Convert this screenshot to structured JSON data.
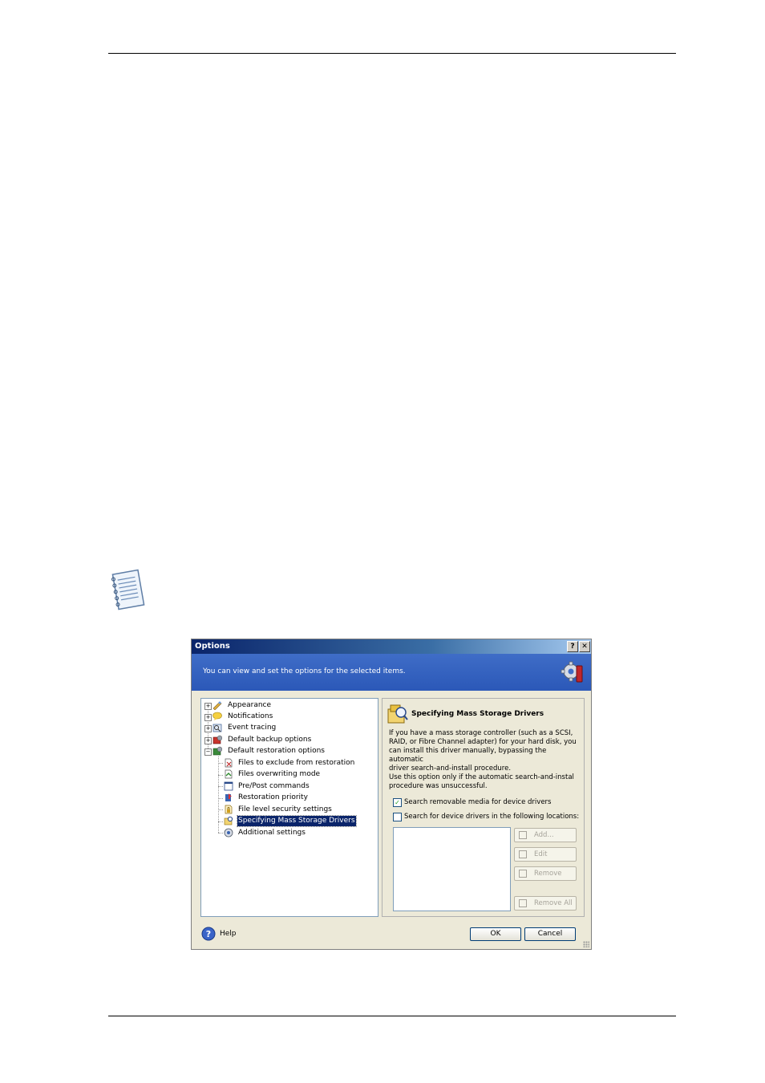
{
  "dialog": {
    "title": "Options",
    "help_btn": "?",
    "close_btn": "✕",
    "header_text": "You can view and set the options for the selected items."
  },
  "tree": {
    "items": [
      {
        "label": "Appearance",
        "expander": "+",
        "icon": "appearance-icon"
      },
      {
        "label": "Notifications",
        "expander": "+",
        "icon": "notifications-icon"
      },
      {
        "label": "Event tracing",
        "expander": "+",
        "icon": "event-tracing-icon"
      },
      {
        "label": "Default backup options",
        "expander": "+",
        "icon": "backup-options-icon"
      },
      {
        "label": "Default restoration options",
        "expander": "−",
        "icon": "restoration-options-icon"
      }
    ],
    "children": [
      {
        "label": "Files to exclude from restoration",
        "icon": "exclude-files-icon"
      },
      {
        "label": "Files overwriting mode",
        "icon": "overwrite-icon"
      },
      {
        "label": "Pre/Post commands",
        "icon": "commands-icon"
      },
      {
        "label": "Restoration priority",
        "icon": "priority-icon"
      },
      {
        "label": "File level security settings",
        "icon": "security-icon"
      },
      {
        "label": "Specifying Mass Storage Drivers",
        "icon": "mass-storage-icon",
        "selected": true
      },
      {
        "label": "Additional settings",
        "icon": "additional-settings-icon"
      }
    ]
  },
  "panel": {
    "title": "Specifying Mass Storage Drivers",
    "para1_lines": [
      "If you have a mass storage controller (such as a SCSI,",
      "RAID, or Fibre Channel adapter) for your hard disk, you",
      "can install this driver manually, bypassing the automatic",
      "driver search-and-install procedure."
    ],
    "para2_lines": [
      "Use this option only if the automatic search-and-instal",
      "procedure was unsuccessful."
    ],
    "check1": {
      "label": "Search removable media for device drivers",
      "checked": true
    },
    "check2": {
      "label": "Search for device drivers in the following locations:",
      "checked": false
    },
    "buttons": {
      "add": "Add...",
      "edit": "Edit",
      "remove": "Remove",
      "remove_all": "Remove All"
    }
  },
  "footer": {
    "help": "Help",
    "ok": "OK",
    "cancel": "Cancel"
  }
}
